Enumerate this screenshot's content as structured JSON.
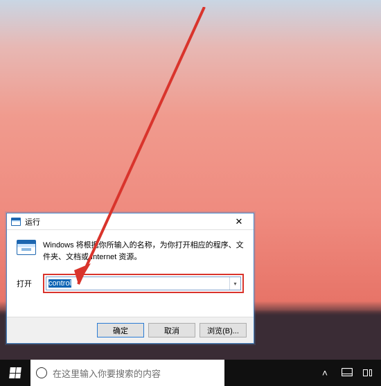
{
  "dialog": {
    "title": "运行",
    "description": "Windows 将根据你所输入的名称，为你打开相应的程序、文件夹、文档或 Internet 资源。",
    "open_label": "打开",
    "input_value": "control",
    "buttons": {
      "ok": "确定",
      "cancel": "取消",
      "browse": "浏览(B)..."
    },
    "close_glyph": "✕",
    "dropdown_glyph": "▾"
  },
  "taskbar": {
    "search_placeholder": "在这里输入你要搜索的内容"
  }
}
